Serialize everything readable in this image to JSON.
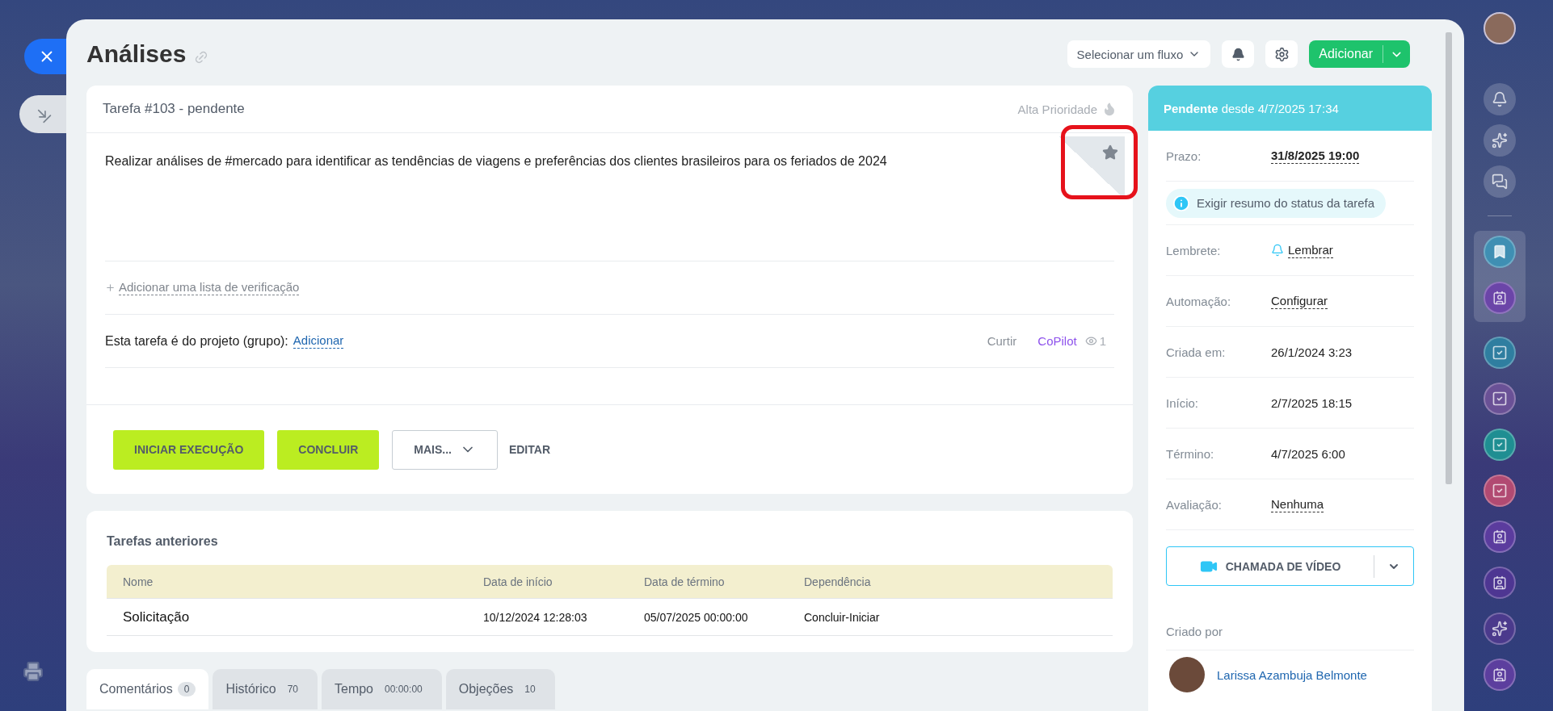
{
  "page": {
    "title": "Análises"
  },
  "toolbar": {
    "flow_select": "Selecionar um fluxo",
    "add_button": "Adicionar"
  },
  "task": {
    "header": "Tarefa #103 - pendente",
    "priority": "Alta Prioridade",
    "high_priority": false,
    "description": "Realizar análises de #mercado para identificar as tendências de viagens e preferências dos clientes brasileiros para os feriados de 2024",
    "checklist_link": "Adicionar uma lista de verificação",
    "project_label": "Esta tarefa é do projeto (grupo):",
    "project_link": "Adicionar",
    "like": "Curtir",
    "copilot": "CoPilot",
    "views": "1",
    "actions": [
      {
        "label": "INICIAR EXECUÇÃO",
        "kind": "primary"
      },
      {
        "label": "CONCLUIR",
        "kind": "primary"
      },
      {
        "label": "MAIS...",
        "kind": "dropdown"
      },
      {
        "label": "EDITAR",
        "kind": "link"
      }
    ]
  },
  "previous_tasks": {
    "title": "Tarefas anteriores",
    "columns": [
      "Nome",
      "Data de início",
      "Data de término",
      "Dependência"
    ],
    "rows": [
      [
        "Solicitação",
        "10/12/2024 12:28:03",
        "05/07/2025 00:00:00",
        "Concluir-Iniciar"
      ]
    ]
  },
  "tabs": [
    {
      "label": "Comentários",
      "count": "0",
      "selected": true
    },
    {
      "label": "Histórico",
      "count": "70",
      "selected": false
    },
    {
      "label": "Tempo",
      "count": "00:00:00",
      "selected": false
    },
    {
      "label": "Objeções",
      "count": "10",
      "selected": false
    }
  ],
  "sidebar": {
    "status": "**Pendente** desde 4/7/2025 17:34",
    "fields": [
      {
        "kind": "deadline",
        "label": "Prazo:",
        "value": "31/8/2025 19:00"
      },
      {
        "kind": "notice",
        "value": "Exigir resumo do status da tarefa"
      },
      {
        "kind": "reminder",
        "label": "Lembrete:",
        "value": "Lembrar"
      },
      {
        "kind": "action",
        "label": "Automação:",
        "value": "Configurar"
      },
      {
        "kind": "plain",
        "label": "Criada em:",
        "value": "26/1/2024 3:23"
      },
      {
        "kind": "plain",
        "label": "Início:",
        "value": "2/7/2025 18:15"
      },
      {
        "kind": "plain",
        "label": "Término:",
        "value": "4/7/2025 6:00"
      },
      {
        "kind": "action",
        "label": "Avaliação:",
        "value": "Nenhuma"
      }
    ],
    "video_button": "CHAMADA DE VÍDEO",
    "creator_label": "Criado por",
    "creator_name": "Larissa Azambuja Belmonte"
  },
  "rail": {
    "top": [
      {
        "kind": "bell"
      },
      {
        "kind": "copilot"
      },
      {
        "kind": "chat"
      }
    ],
    "pinned": [
      {
        "kind": "bookmark",
        "color": "#3f8fb3"
      },
      {
        "kind": "contact",
        "color": "#6b45a8"
      }
    ],
    "apps": [
      {
        "kind": "task",
        "color": "#2f7ea0"
      },
      {
        "kind": "task",
        "color": "#6a5196"
      },
      {
        "kind": "task",
        "color": "#1f8e92"
      },
      {
        "kind": "task",
        "color": "#b14a72"
      },
      {
        "kind": "contact",
        "color": "#5b3c9e"
      },
      {
        "kind": "contact",
        "color": "#4e3692"
      },
      {
        "kind": "copilot",
        "color": "#4b3a8c"
      },
      {
        "kind": "contact",
        "color": "#5c3e9e"
      }
    ]
  }
}
